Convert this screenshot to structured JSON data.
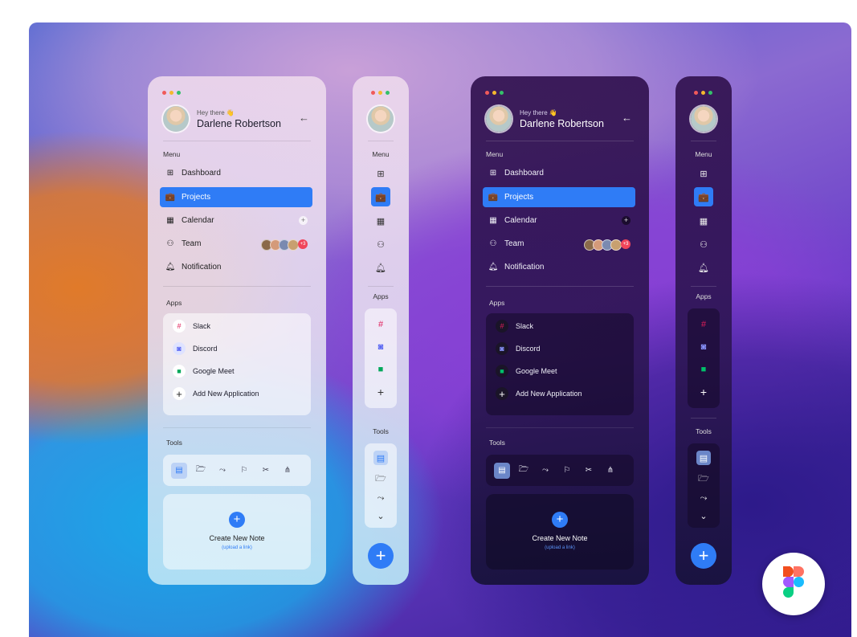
{
  "user": {
    "greeting": "Hey there 👋",
    "name": "Darlene Robertson"
  },
  "sections": {
    "menu": "Menu",
    "apps": "Apps",
    "tools": "Tools"
  },
  "menu": [
    {
      "label": "Dashboard",
      "icon": "grid-icon"
    },
    {
      "label": "Projects",
      "icon": "briefcase-icon",
      "active": true
    },
    {
      "label": "Calendar",
      "icon": "calendar-icon"
    },
    {
      "label": "Team",
      "icon": "team-icon",
      "badge": "+3"
    },
    {
      "label": "Notification",
      "icon": "bell-icon"
    }
  ],
  "apps": [
    {
      "label": "Slack",
      "icon": "slack-icon"
    },
    {
      "label": "Discord",
      "icon": "discord-icon"
    },
    {
      "label": "Google Meet",
      "icon": "google-meet-icon"
    },
    {
      "label": "Add New Application",
      "icon": "plus-icon"
    }
  ],
  "tools": [
    "document-icon",
    "folder-icon",
    "route-icon",
    "flag-icon",
    "scissors-icon",
    "sitemap-icon"
  ],
  "note": {
    "title": "Create New Note",
    "subtitle": "(upload a link)"
  },
  "colors": {
    "accent": "#2f7cf6",
    "badge": "#f0455a",
    "dot_red": "#f05a5a",
    "dot_yellow": "#f5b82e",
    "dot_green": "#34c06a"
  }
}
